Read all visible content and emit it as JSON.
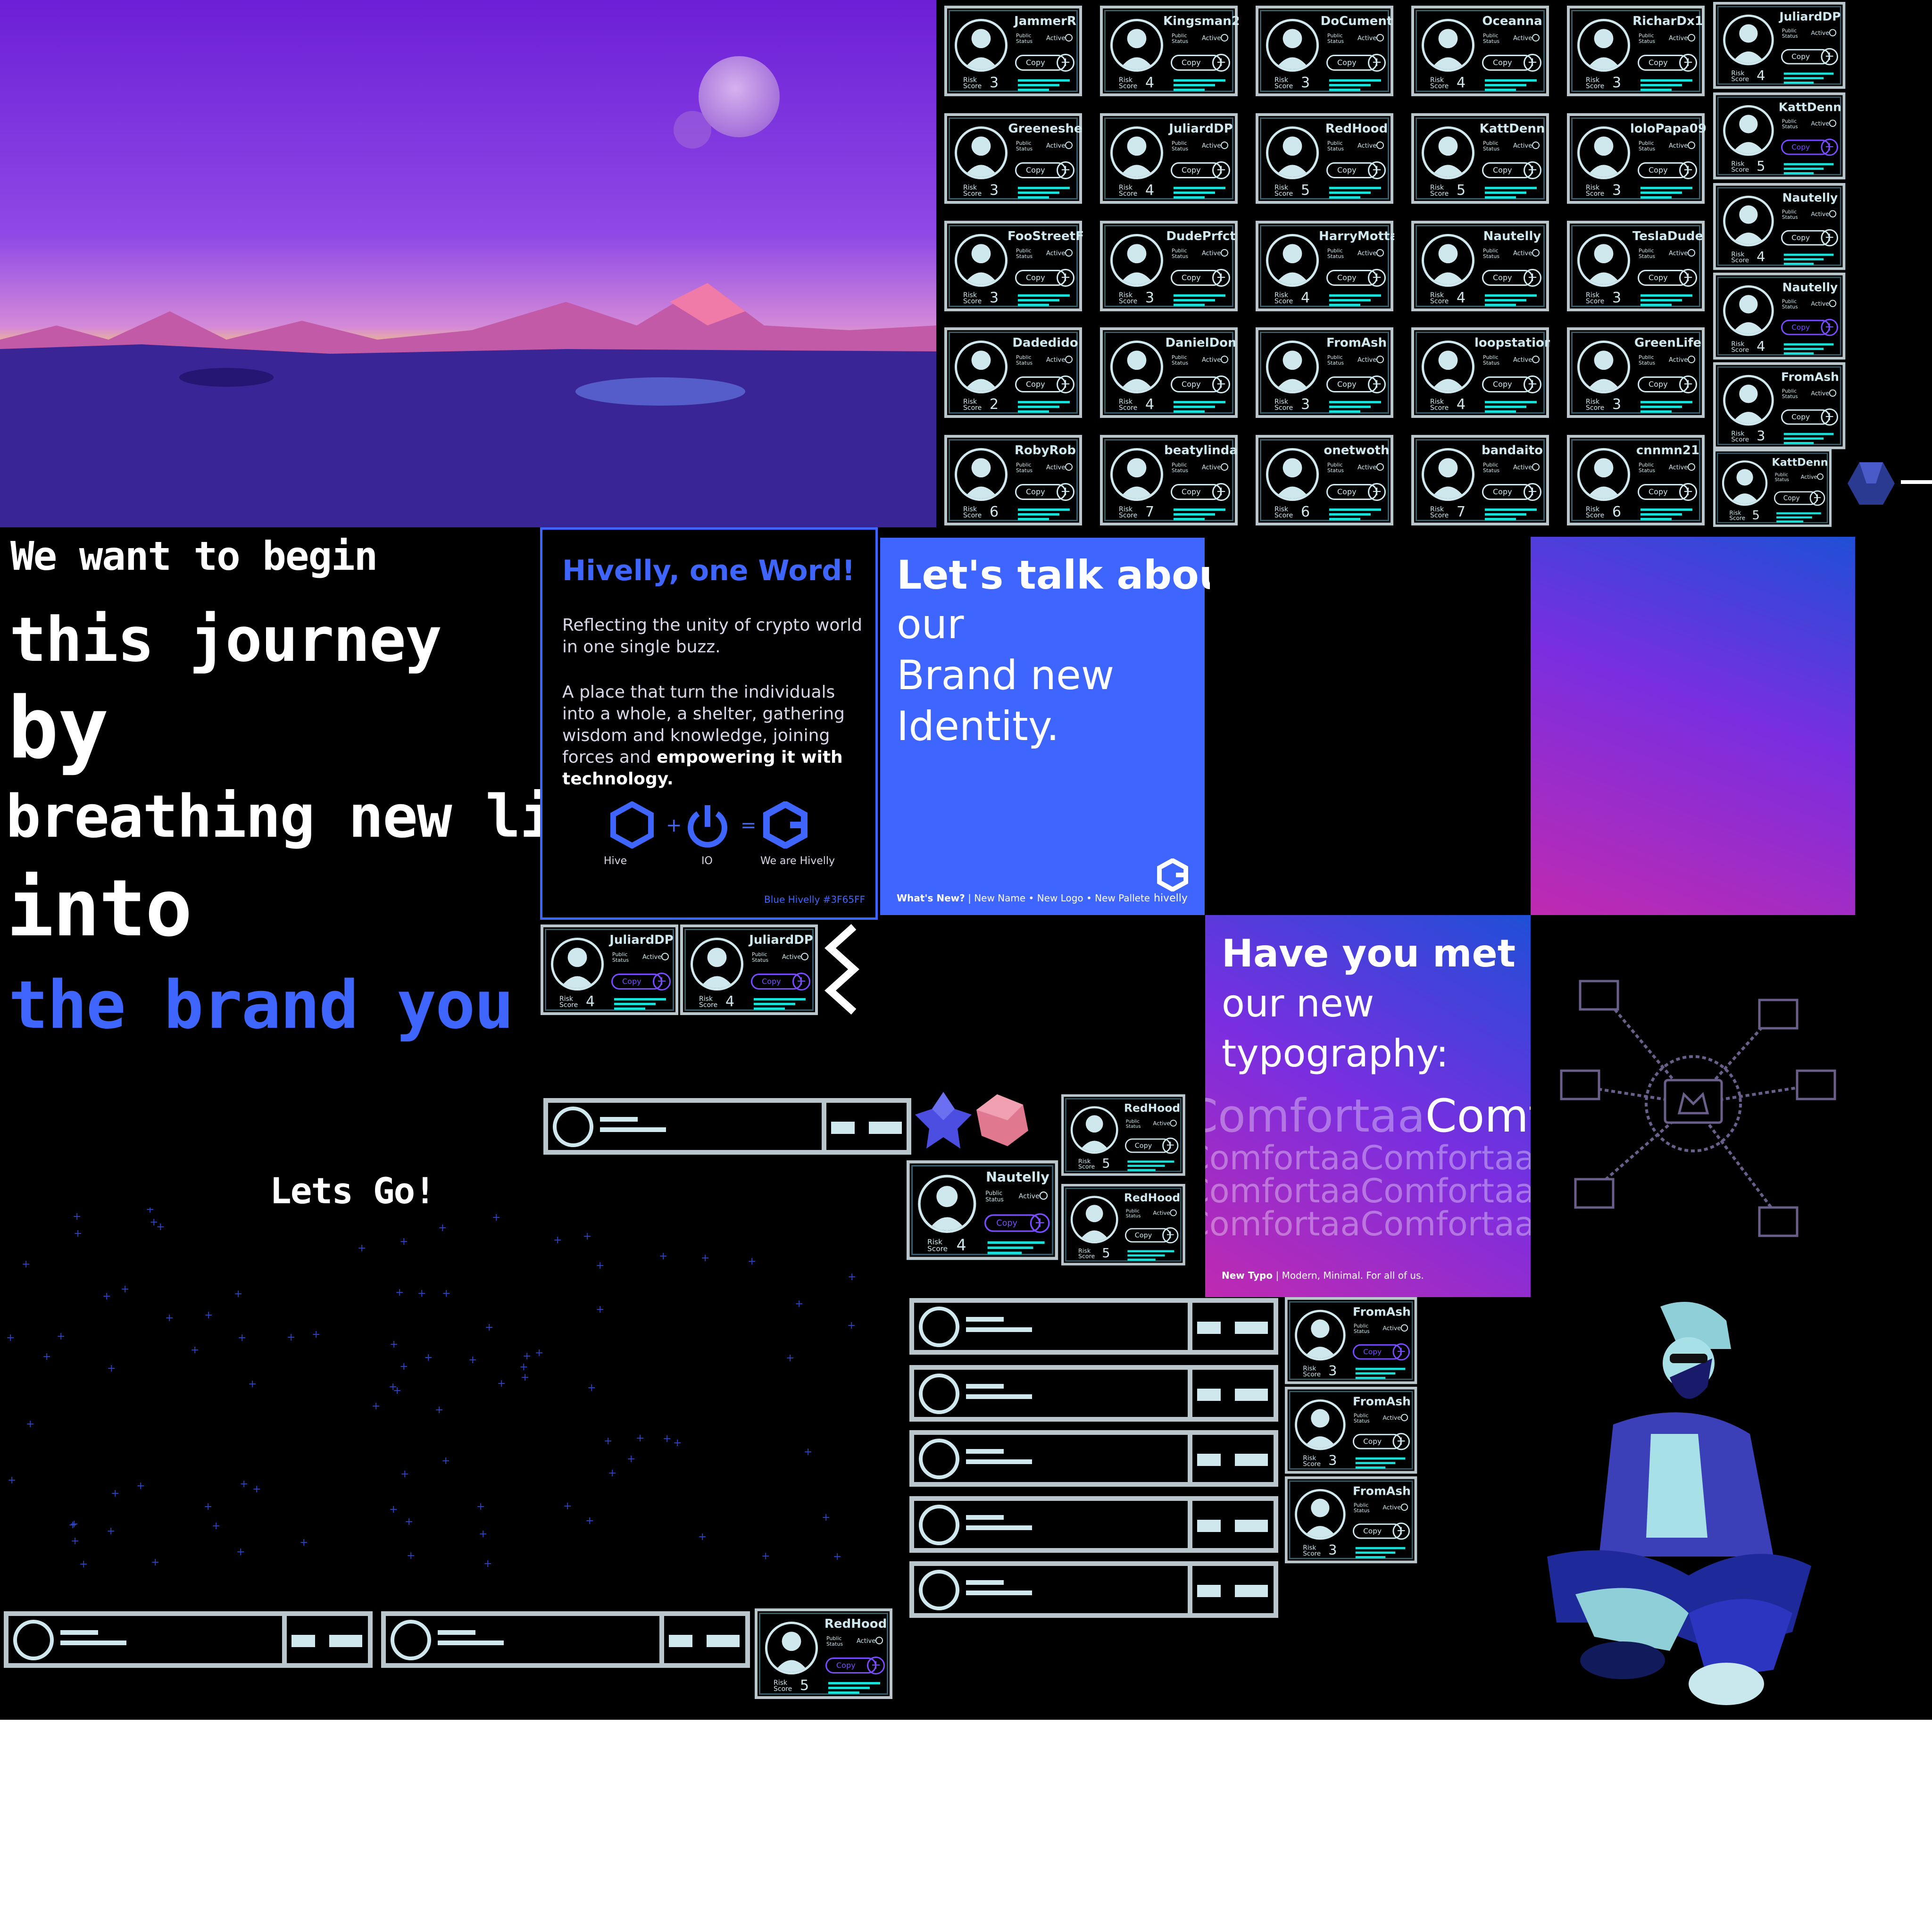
{
  "colors": {
    "accent": "#3f65ff",
    "cyan": "#19e0d8",
    "card_border": "#b9c6cc",
    "background": "#000000"
  },
  "hero": {
    "lines": [
      "We want to begin",
      "this journey",
      "by",
      "breathing new life",
      "into",
      "the brand you"
    ],
    "cta": "Lets Go!"
  },
  "hivelly_panel": {
    "title": "Hivelly, one Word!",
    "p1": "Reflecting the unity of crypto world in one single buzz.",
    "p2_a": "A place that turn the individuals into a whole, a shelter, gathering wisdom and knowledge, joining forces and ",
    "p2_b": "empowering it with technology.",
    "icons": [
      {
        "icon": "hexagon-icon",
        "label": "Hive"
      },
      {
        "icon": "power-icon",
        "label": "IO"
      },
      {
        "icon": "hivelly-logo-icon",
        "label": "We are Hivelly"
      }
    ],
    "plus": "+",
    "equals": "=",
    "footer": "Blue Hivelly #3F65FF"
  },
  "identity_panel": {
    "title": "Let's talk about",
    "lines": [
      "our",
      "Brand new",
      "Identity."
    ],
    "footer_bold": "What's New?",
    "footer_sep": " | ",
    "footer_items": "New Name • New Logo • New Pallete",
    "logo_label": "hivelly"
  },
  "typo_panel": {
    "title": "Have you met",
    "lines": [
      "our new",
      "typography:"
    ],
    "font_word": "Comfortaa",
    "footer_bold": "New Typo",
    "footer_rest": " | Modern, Minimal. For all of us."
  },
  "card_labels": {
    "public": "Public",
    "status": "Status",
    "active": "Active",
    "copy": "Copy",
    "risk": "Risk",
    "score": "Score",
    "plus": "+"
  },
  "grid_cards": [
    {
      "name": "JammerR",
      "score": "3"
    },
    {
      "name": "Kingsman2",
      "score": "4"
    },
    {
      "name": "DoCument",
      "score": "3"
    },
    {
      "name": "Oceanna",
      "score": "4"
    },
    {
      "name": "RicharDx1",
      "score": "3"
    },
    {
      "name": "Greeneshe",
      "score": "3"
    },
    {
      "name": "JuliardDP",
      "score": "4"
    },
    {
      "name": "RedHood",
      "score": "5"
    },
    {
      "name": "KattDenn",
      "score": "5"
    },
    {
      "name": "loloPapa09",
      "score": "3"
    },
    {
      "name": "FooStreetF",
      "score": "3"
    },
    {
      "name": "DudePrfct",
      "score": "3"
    },
    {
      "name": "HarryMotta",
      "score": "4"
    },
    {
      "name": "Nautelly",
      "score": "4"
    },
    {
      "name": "TeslaDude",
      "score": "3"
    },
    {
      "name": "Dadedido",
      "score": "2"
    },
    {
      "name": "DanielDon",
      "score": "4"
    },
    {
      "name": "FromAsh",
      "score": "3"
    },
    {
      "name": "loopstation",
      "score": "4"
    },
    {
      "name": "GreenLife",
      "score": "3"
    },
    {
      "name": "RobyRob",
      "score": "6"
    },
    {
      "name": "beatylinda",
      "score": "7"
    },
    {
      "name": "onetwoth",
      "score": "6"
    },
    {
      "name": "bandaito",
      "score": "7"
    },
    {
      "name": "cnnmn21",
      "score": "6"
    }
  ],
  "side_cards": [
    {
      "name": "JuliardDP",
      "score": "4"
    },
    {
      "name": "KattDenn",
      "score": "5"
    },
    {
      "name": "Nautelly",
      "score": "4"
    },
    {
      "name": "Nautelly",
      "score": "4"
    },
    {
      "name": "FromAsh",
      "score": "3"
    },
    {
      "name": "KattDenn",
      "score": "5"
    }
  ],
  "mid_cards": [
    {
      "name": "JuliardDP",
      "score": "4"
    },
    {
      "name": "JuliardDP",
      "score": "4"
    },
    {
      "name": "RedHood",
      "score": "5"
    },
    {
      "name": "Nautelly",
      "score": "4"
    },
    {
      "name": "RedHood",
      "score": "5"
    },
    {
      "name": "FromAsh",
      "score": "3"
    },
    {
      "name": "FromAsh",
      "score": "3"
    },
    {
      "name": "FromAsh",
      "score": "3"
    },
    {
      "name": "RedHood",
      "score": "5"
    }
  ]
}
